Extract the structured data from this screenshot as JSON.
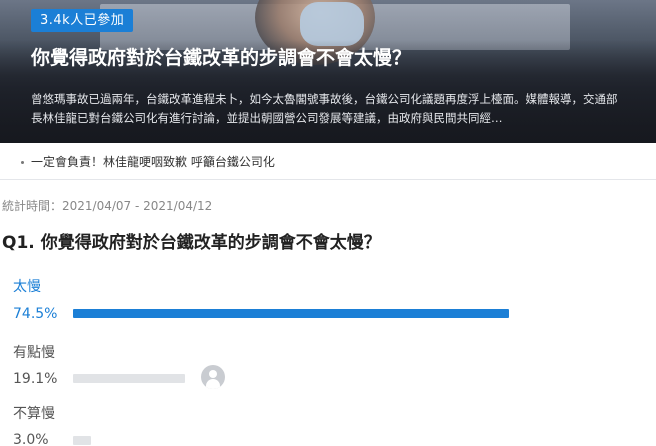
{
  "hero": {
    "badge": "3.4k人已參加",
    "title": "你覺得政府對於台鐵改革的步調會不會太慢？",
    "description": "曾悠瑪事故已過兩年，台鐵改革進程未卜，如今太魯閣號事故後，台鐵公司化議題再度浮上檯面。媒體報導，交通部長林佳龍已對台鐵公司化有進行討論，並提出朝國營公司發展等建議，由政府與民間共同經…"
  },
  "related": {
    "link_text": "一定會負責！林佳龍哽咽致歉 呼籲台鐵公司化"
  },
  "poll": {
    "period": "統計時間：2021/04/07 - 2021/04/12",
    "question_number": "Q1.",
    "question": "你覺得政府對於台鐵改革的步調會不會太慢？",
    "options": [
      {
        "label": "太慢",
        "percent": "74.5%",
        "value": 74.5,
        "selected": true
      },
      {
        "label": "有點慢",
        "percent": "19.1%",
        "value": 19.1,
        "selected": false
      },
      {
        "label": "不算慢",
        "percent": "3.0%",
        "value": 3.0,
        "selected": false
      }
    ]
  },
  "colors": {
    "accent": "#1b7fd6",
    "bar_inactive": "#e1e3e6",
    "label_inactive": "#555555"
  },
  "icons": {
    "voter_avatar": "user-avatar-icon"
  }
}
